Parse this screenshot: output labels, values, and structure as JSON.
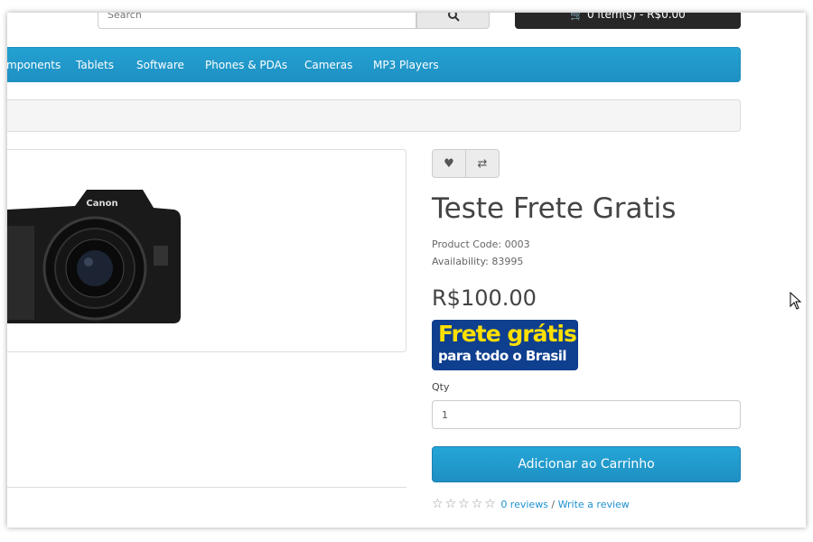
{
  "header": {
    "search_placeholder": "Search",
    "cart_label": "0 item(s) - R$0.00"
  },
  "menu": {
    "items": [
      "mponents",
      "Tablets",
      "Software",
      "Phones & PDAs",
      "Cameras",
      "MP3 Players"
    ]
  },
  "product": {
    "title": "Teste Frete Gratis",
    "product_code": "Product Code: 0003",
    "availability": "Availability: 83995",
    "price": "R$100.00",
    "badge_line1": "Frete grátis",
    "badge_line2": "para todo o Brasil",
    "camera_brand": "Canon",
    "qty_label": "Qty",
    "qty_value": "1",
    "add_to_cart": "Adicionar ao Carrinho",
    "reviews_link": "0 reviews",
    "separator": "/",
    "write_review_link": "Write a review",
    "rating_stars": 0,
    "max_stars": 5
  },
  "colors": {
    "menu_blue": "#229ac8",
    "badge_navy": "#0f3f8f",
    "badge_yellow": "#ffe000",
    "link_blue": "#1e91cf"
  }
}
